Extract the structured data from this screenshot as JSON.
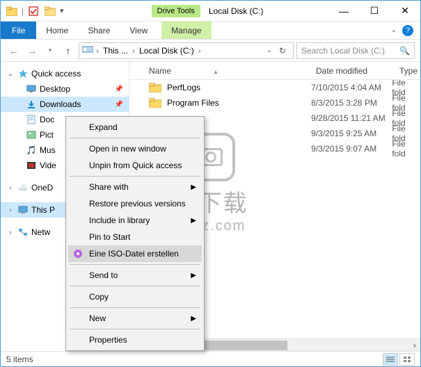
{
  "window": {
    "title": "Local Disk (C:)",
    "drive_tools_label": "Drive Tools"
  },
  "tabs": {
    "file": "File",
    "home": "Home",
    "share": "Share",
    "view": "View",
    "manage": "Manage"
  },
  "address": {
    "root": "This ...",
    "current": "Local Disk (C:)"
  },
  "search": {
    "placeholder": "Search Local Disk (C:)"
  },
  "nav": {
    "quick_access": "Quick access",
    "desktop": "Desktop",
    "downloads": "Downloads",
    "documents": "Doc",
    "pictures": "Pict",
    "music": "Mus",
    "videos": "Vide",
    "onedrive": "OneD",
    "this_pc": "This P",
    "network": "Netw"
  },
  "columns": {
    "name": "Name",
    "date": "Date modified",
    "type": "Type"
  },
  "files": [
    {
      "name": "PerfLogs",
      "date": "7/10/2015 4:04 AM",
      "type": "File fold"
    },
    {
      "name": "Program Files",
      "date": "8/3/2015 3:28 PM",
      "type": "File fold"
    },
    {
      "name": "",
      "date": "9/28/2015 11:21 AM",
      "type": "File fold"
    },
    {
      "name": "",
      "date": "9/3/2015 9:25 AM",
      "type": "File fold"
    },
    {
      "name": "",
      "date": "9/3/2015 9:07 AM",
      "type": "File fold"
    }
  ],
  "context_menu": {
    "expand": "Expand",
    "open_new_window": "Open in new window",
    "unpin": "Unpin from Quick access",
    "share_with": "Share with",
    "restore_prev": "Restore previous versions",
    "include_library": "Include in library",
    "pin_start": "Pin to Start",
    "iso_create": "Eine ISO-Datei erstellen",
    "send_to": "Send to",
    "copy": "Copy",
    "new": "New",
    "properties": "Properties"
  },
  "statusbar": {
    "count": "5 items"
  },
  "watermark": {
    "cn": "安下载",
    "url": "anxz.com"
  }
}
